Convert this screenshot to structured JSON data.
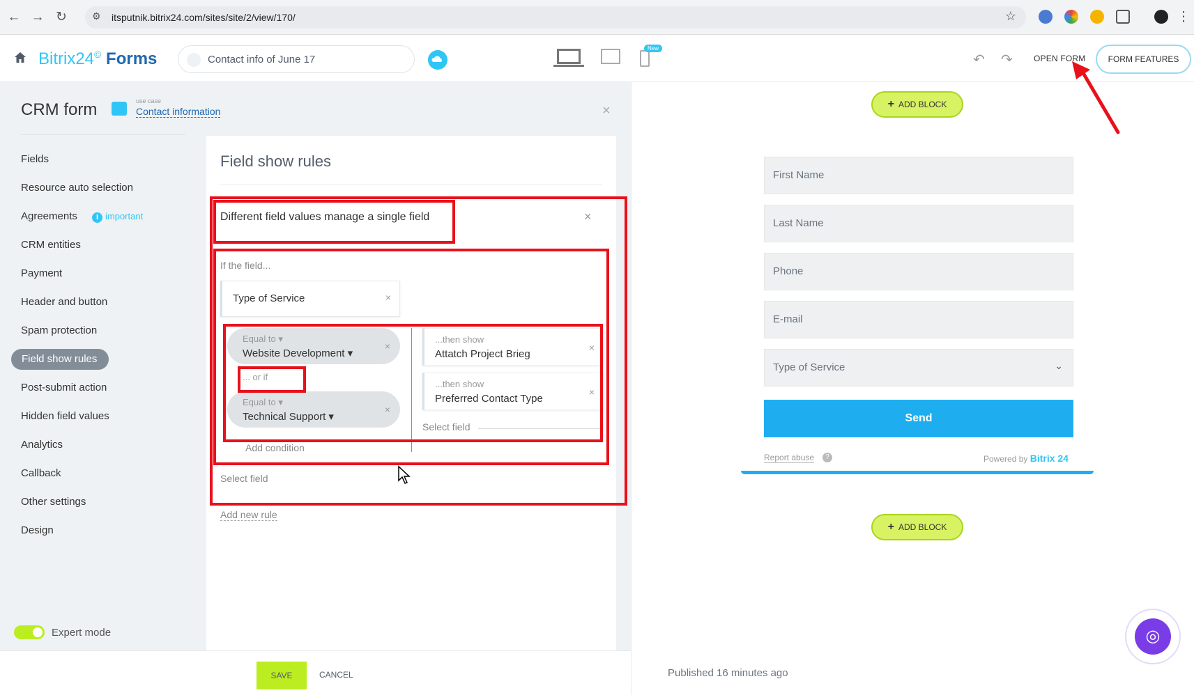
{
  "browser": {
    "url": "itsputnik.bitrix24.com/sites/site/2/view/170/"
  },
  "header": {
    "logo_main": "Bitrix24",
    "logo_circle": "©",
    "logo_product": "Forms",
    "form_name": "Contact info of June 17",
    "new_badge": "New",
    "open_form": "OPEN FORM",
    "form_features": "FORM FEATURES"
  },
  "sidebar": {
    "title": "CRM form",
    "use_case_label": "use case",
    "use_case_link": "Contact information",
    "important": "important",
    "items": [
      "Fields",
      "Resource auto selection",
      "Agreements",
      "CRM entities",
      "Payment",
      "Header and button",
      "Spam protection",
      "Field show rules",
      "Post-submit action",
      "Hidden field values",
      "Analytics",
      "Callback",
      "Other settings",
      "Design"
    ],
    "expert_mode": "Expert mode",
    "toggle_text": "ON"
  },
  "rules": {
    "title": "Field show rules",
    "rule_title": "Different field values manage a single field",
    "if_field": "If the field...",
    "field": "Type of Service",
    "conditions": [
      {
        "op": "Equal to ▾",
        "value": "Website Development ▾"
      },
      {
        "op": "Equal to ▾",
        "value": "Technical Support ▾"
      }
    ],
    "or_if": "... or if",
    "add_condition": "Add condition",
    "then_show": [
      {
        "label": "...then show",
        "value": "Attatch Project Brieg"
      },
      {
        "label": "...then show",
        "value": "Preferred Contact Type"
      }
    ],
    "select_field_inner": "Select field",
    "select_field_outer": "Select field",
    "add_new_rule": "Add new rule"
  },
  "actions": {
    "save": "SAVE",
    "cancel": "CANCEL"
  },
  "preview": {
    "add_block": "ADD BLOCK",
    "fields": [
      "First Name",
      "Last Name",
      "Phone",
      "E-mail"
    ],
    "select_field": "Type of Service",
    "send": "Send",
    "report_abuse": "Report abuse",
    "powered_by": "Powered by",
    "powered_brand": "Bitrix 24",
    "published": "Published 16 minutes ago"
  },
  "colors": {
    "accent": "#2fc6f6",
    "brand_dark": "#2067b0",
    "save_green": "#bbed21",
    "send_blue": "#1eaef0",
    "annotation_red": "#e8111b"
  }
}
